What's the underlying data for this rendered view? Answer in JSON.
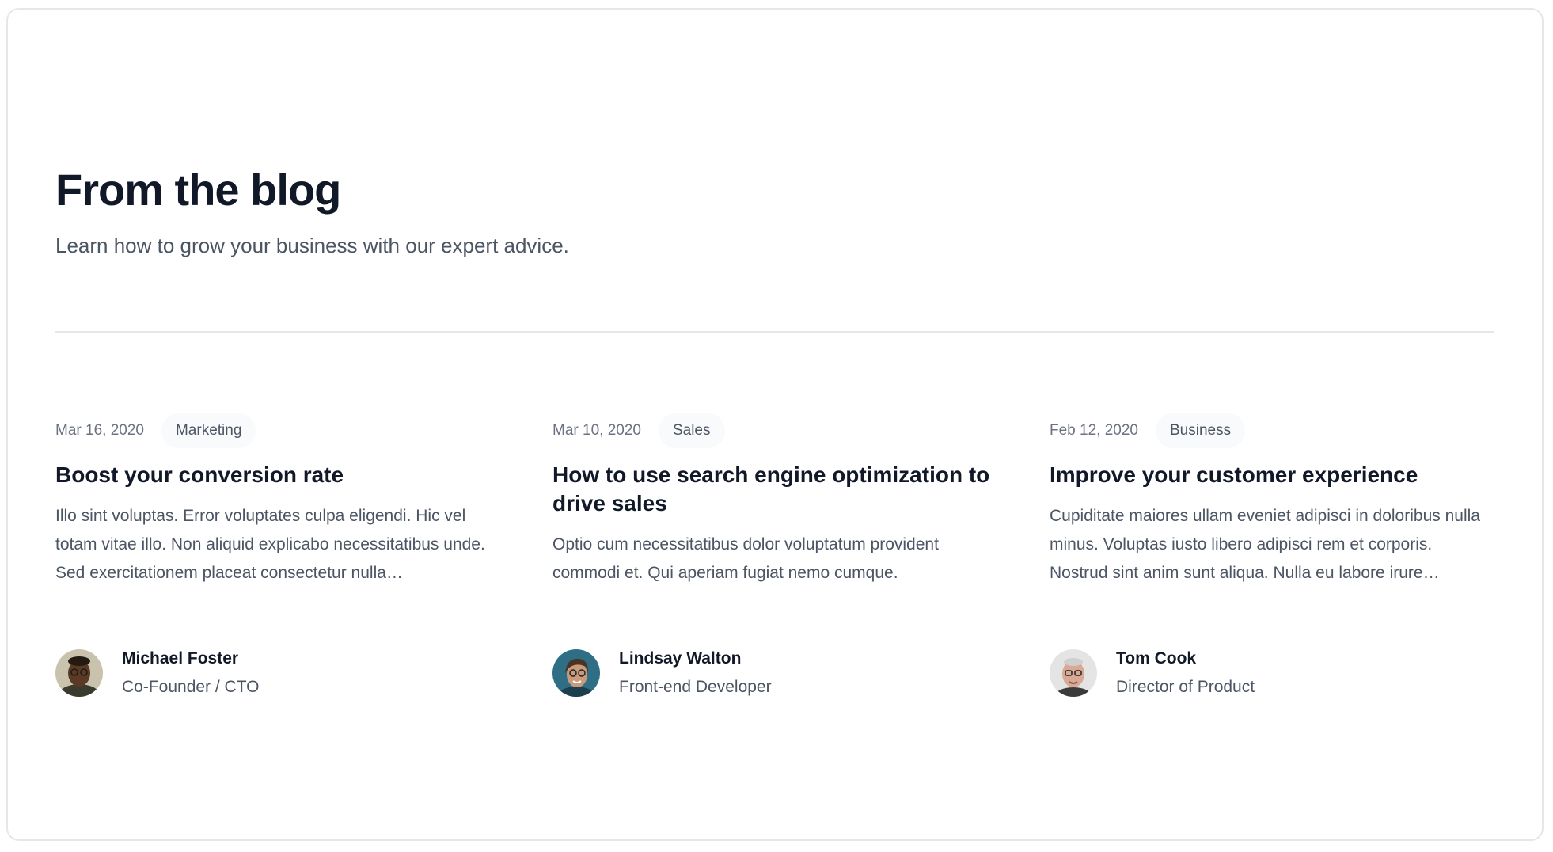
{
  "section": {
    "heading": "From the blog",
    "subtitle": "Learn how to grow your business with our expert advice."
  },
  "posts": [
    {
      "date": "Mar 16, 2020",
      "category": "Marketing",
      "title": "Boost your conversion rate",
      "excerpt": "Illo sint voluptas. Error voluptates culpa eligendi. Hic vel totam vitae illo. Non aliquid explicabo necessitatibus unde. Sed exercitationem placeat consectetur nulla…",
      "author": {
        "name": "Michael Foster",
        "role": "Co-Founder / CTO"
      }
    },
    {
      "date": "Mar 10, 2020",
      "category": "Sales",
      "title": "How to use search engine optimization to drive sales",
      "excerpt": "Optio cum necessitatibus dolor voluptatum provident commodi et. Qui aperiam fugiat nemo cumque.",
      "author": {
        "name": "Lindsay Walton",
        "role": "Front-end Developer"
      }
    },
    {
      "date": "Feb 12, 2020",
      "category": "Business",
      "title": "Improve your customer experience",
      "excerpt": "Cupiditate maiores ullam eveniet adipisci in doloribus nulla minus. Voluptas iusto libero adipisci rem et corporis. Nostrud sint anim sunt aliqua. Nulla eu labore irure…",
      "author": {
        "name": "Tom Cook",
        "role": "Director of Product"
      }
    }
  ]
}
